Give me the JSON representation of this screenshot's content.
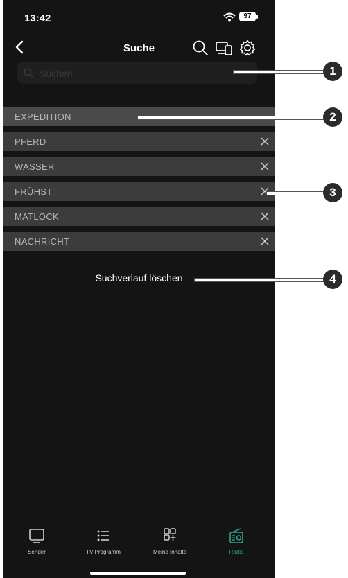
{
  "status": {
    "time": "13:42",
    "battery": "97"
  },
  "header": {
    "title": "Suche"
  },
  "search": {
    "placeholder": "Suchen"
  },
  "history": [
    "EXPEDITION",
    "PFERD",
    "WASSER",
    "FRÜHST",
    "MATLOCK",
    "NACHRICHT"
  ],
  "clear_label": "Suchverlauf löschen",
  "tabs": [
    {
      "label": "Sender",
      "icon": "tv-icon"
    },
    {
      "label": "TV-Programm",
      "icon": "list-icon"
    },
    {
      "label": "Meine Inhalte",
      "icon": "grid-plus-icon"
    },
    {
      "label": "Radio",
      "icon": "radio-icon",
      "active": true
    }
  ],
  "callouts": [
    "1",
    "2",
    "3",
    "4"
  ],
  "colors": {
    "background": "#141414",
    "row": "#3c3c3c",
    "accent": "#2ea58f"
  }
}
